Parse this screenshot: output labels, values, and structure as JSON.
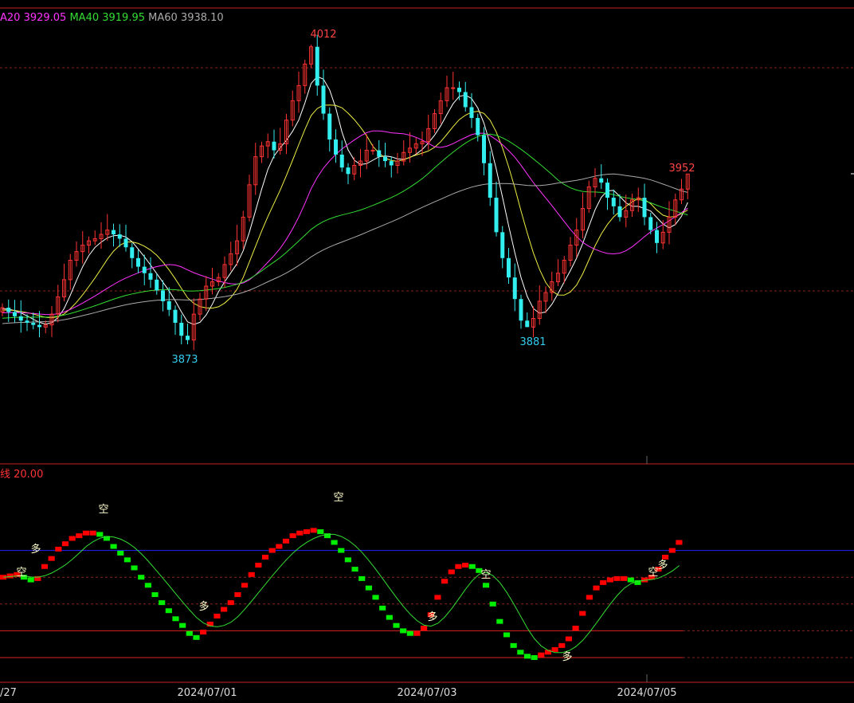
{
  "legend_main": [
    {
      "label": "A20",
      "value": "3929.05",
      "color": "#ff33ff"
    },
    {
      "label": "MA40",
      "value": "3919.95",
      "color": "#33dd33"
    },
    {
      "label": "MA60",
      "value": "3938.10",
      "color": "#aaaaaa"
    }
  ],
  "legend_indicator": {
    "label": "线 20.00",
    "color": "#ff3333"
  },
  "price_annotations": [
    {
      "text": "4012",
      "color": "#ff4444"
    },
    {
      "text": "3952",
      "color": "#ff4444"
    },
    {
      "text": "3873",
      "color": "#33ccee"
    },
    {
      "text": "3881",
      "color": "#33ccee"
    }
  ],
  "date_labels": [
    "/27",
    "2024/07/01",
    "2024/07/03",
    "2024/07/05"
  ],
  "signal_marks": [
    {
      "text": "空"
    },
    {
      "text": "多"
    },
    {
      "text": "空"
    },
    {
      "text": "多"
    },
    {
      "text": "空"
    },
    {
      "text": "多"
    },
    {
      "text": "空"
    },
    {
      "text": "多"
    },
    {
      "text": "空"
    },
    {
      "text": "多"
    }
  ],
  "colors": {
    "up": "#ff3333",
    "down": "#33eeee",
    "ind_up": "#ff0000",
    "ind_down": "#00ee00",
    "ma_white": "#ffffff",
    "ma_yellow": "#eeee44",
    "ma_pink": "#ff33ff",
    "ma_green": "#33dd33",
    "ma_grey": "#aaaaaa",
    "frame": "#cc2222",
    "blue_line": "#2222ff"
  },
  "chart_data": {
    "type": "candlestick",
    "price_range": [
      3840,
      4030
    ],
    "price_path": [
      3890,
      3888,
      3886,
      3884,
      3883,
      3882,
      3881,
      3882,
      3887,
      3895,
      3903,
      3912,
      3916,
      3919,
      3921,
      3922,
      3924,
      3926,
      3924,
      3922,
      3918,
      3913,
      3909,
      3906,
      3903,
      3898,
      3893,
      3889,
      3883,
      3877,
      3875,
      3887,
      3894,
      3900,
      3902,
      3904,
      3910,
      3915,
      3921,
      3932,
      3947,
      3960,
      3965,
      3967,
      3963,
      3966,
      3977,
      3986,
      3993,
      4003,
      4011,
      3993,
      3980,
      3968,
      3961,
      3955,
      3952,
      3956,
      3958,
      3963,
      3963,
      3960,
      3958,
      3956,
      3958,
      3962,
      3964,
      3966,
      3967,
      3973,
      3980,
      3986,
      3992,
      3992,
      3990,
      3983,
      3978,
      3970,
      3957,
      3941,
      3925,
      3913,
      3904,
      3894,
      3884,
      3881,
      3885,
      3893,
      3897,
      3902,
      3906,
      3912,
      3919,
      3926,
      3936,
      3946,
      3950,
      3948,
      3941,
      3937,
      3932,
      3935,
      3940,
      3941,
      3932,
      3926,
      3920,
      3925,
      3932,
      3940,
      3945,
      3952
    ],
    "indicator_range": [
      -12,
      108
    ],
    "indicator_reference_levels": [
      80,
      0,
      20,
      60,
      40
    ],
    "indicator_path": [
      60,
      61,
      62,
      60,
      58,
      59,
      68,
      74,
      81,
      85,
      89,
      91,
      93,
      93,
      92,
      89,
      83,
      78,
      73,
      67,
      60,
      54,
      47,
      41,
      35,
      29,
      24,
      18,
      15,
      19,
      25,
      31,
      36,
      41,
      47,
      54,
      62,
      69,
      75,
      80,
      83,
      87,
      91,
      93,
      94,
      95,
      94,
      91,
      86,
      80,
      73,
      66,
      59,
      52,
      45,
      37,
      30,
      24,
      20,
      18,
      18,
      22,
      32,
      45,
      57,
      64,
      68,
      69,
      68,
      65,
      54,
      40,
      27,
      17,
      9,
      4,
      1,
      0,
      2,
      4,
      6,
      9,
      14,
      22,
      33,
      45,
      52,
      56,
      58,
      59,
      59,
      58,
      56,
      58,
      60,
      66,
      75,
      80,
      86
    ]
  }
}
